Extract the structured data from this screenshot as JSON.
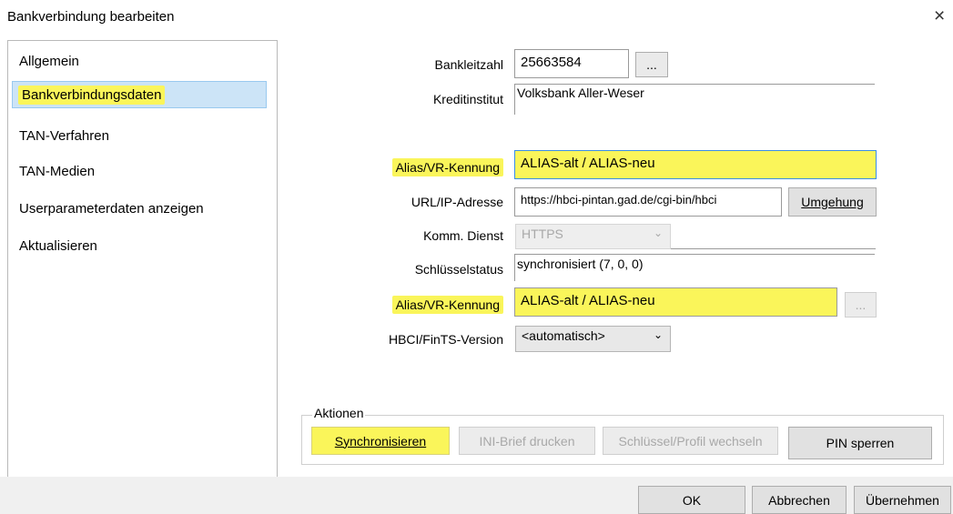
{
  "window": {
    "title": "Bankverbindung bearbeiten",
    "close_glyph": "×"
  },
  "sidebar": {
    "items": [
      {
        "label": "Allgemein"
      },
      {
        "label": "Bankverbindungsdaten"
      },
      {
        "label": "TAN-Verfahren"
      },
      {
        "label": "TAN-Medien"
      },
      {
        "label": "Userparameterdaten anzeigen"
      },
      {
        "label": "Aktualisieren"
      }
    ]
  },
  "form": {
    "bankleitzahl": {
      "label": "Bankleitzahl",
      "value": "25663584",
      "browse": "..."
    },
    "kreditinstitut": {
      "label": "Kreditinstitut",
      "value": "Volksbank Aller-Weser"
    },
    "alias1": {
      "label": "Alias/VR-Kennung",
      "value": "ALIAS-alt / ALIAS-neu"
    },
    "url": {
      "label": "URL/IP-Adresse",
      "value": "https://hbci-pintan.gad.de/cgi-bin/hbci",
      "button": "Umgehung"
    },
    "komm": {
      "label": "Komm. Dienst",
      "value": "HTTPS"
    },
    "schluessel": {
      "label": "Schlüsselstatus",
      "value": "synchronisiert (7, 0, 0)"
    },
    "alias2": {
      "label": "Alias/VR-Kennung",
      "value": "ALIAS-alt / ALIAS-neu",
      "browse": "..."
    },
    "version": {
      "label": "HBCI/FinTS-Version",
      "value": "<automatisch>"
    }
  },
  "actions": {
    "group_label": "Aktionen",
    "synchronisieren": "Synchronisieren",
    "ini_brief": "INI-Brief drucken",
    "schluessel_profil": "Schlüssel/Profil wechseln",
    "pin_sperren": "PIN sperren"
  },
  "footer": {
    "ok": "OK",
    "abbrechen": "Abbrechen",
    "uebernehmen": "Übernehmen"
  },
  "colors": {
    "highlight": "#faf55a",
    "selection": "#cce4f7"
  },
  "icons": {
    "dropdown": "chevron-down-icon",
    "close": "close-icon"
  }
}
